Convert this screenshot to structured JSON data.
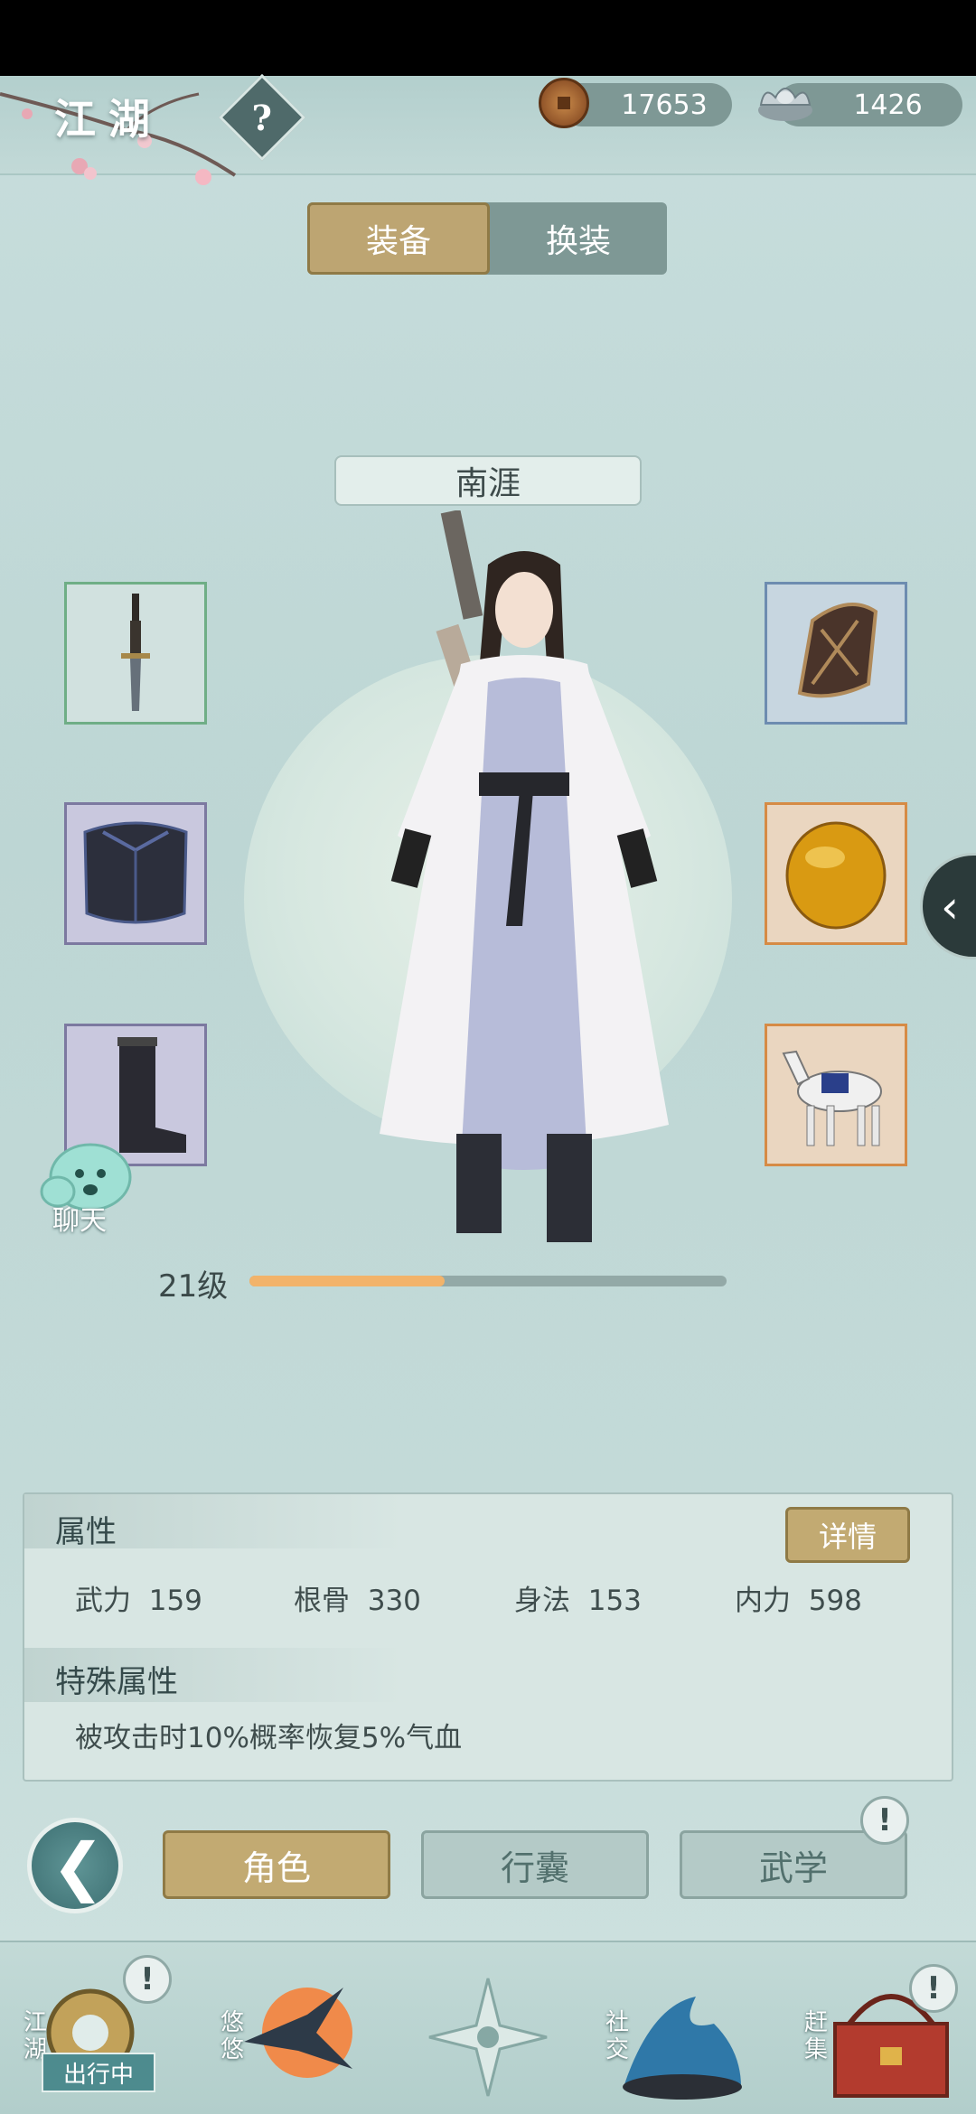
{
  "header": {
    "title": "江湖",
    "help_symbol": "?",
    "copper_amount": "17653",
    "silver_amount": "1426"
  },
  "top_tabs": [
    {
      "label": "装备",
      "active": true
    },
    {
      "label": "换装",
      "active": false
    }
  ],
  "character": {
    "name": "南涯",
    "level_text": "21级",
    "exp_fraction": 0.41
  },
  "equipment": {
    "weapon": "sword-icon",
    "armor": "armor-icon",
    "boots": "boots-icon",
    "bracer": "bracer-icon",
    "accessory": "amber-gem-icon",
    "mount": "horse-icon"
  },
  "chat": {
    "label": "聊天"
  },
  "attributes": {
    "title": "属性",
    "detail_button": "详情",
    "stats": [
      {
        "name": "武力",
        "value": "159"
      },
      {
        "name": "根骨",
        "value": "330"
      },
      {
        "name": "身法",
        "value": "153"
      },
      {
        "name": "内力",
        "value": "598"
      }
    ],
    "special_title": "特殊属性",
    "special_desc": "被攻击时10%概率恢复5%气血"
  },
  "bottom_tabs": [
    {
      "label": "角色",
      "active": true
    },
    {
      "label": "行囊",
      "active": false
    },
    {
      "label": "武学",
      "active": false
    }
  ],
  "alert_symbol": "!",
  "dock": {
    "items": [
      {
        "label": "江湖",
        "badge": "出行中"
      },
      {
        "label": "悠悠"
      },
      {
        "label": ""
      },
      {
        "label": "社交"
      },
      {
        "label": "赶集"
      }
    ]
  },
  "colors": {
    "accent_gold": "#c2aa72",
    "panel_bg": "#d8e6e3",
    "exp_fill": "#f2b36a"
  }
}
